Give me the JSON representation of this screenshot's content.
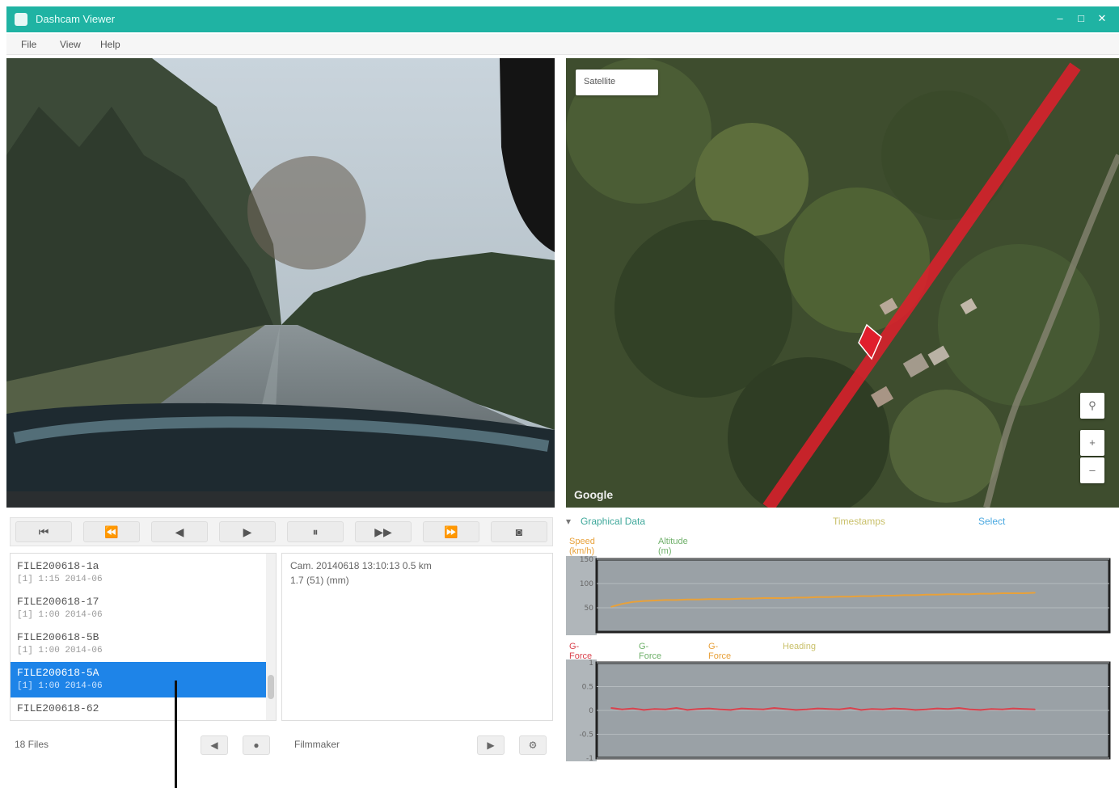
{
  "window": {
    "title": "Dashcam Viewer",
    "controls": [
      "–",
      "□",
      "✕"
    ]
  },
  "menu": [
    "File",
    "View",
    "Help"
  ],
  "map": {
    "type_selector": "Satellite",
    "zoom_in": "+",
    "zoom_out": "–",
    "pegman_icon": "person-icon",
    "logo": "Google"
  },
  "playback": {
    "buttons": [
      "skip-back-icon",
      "rewind-icon",
      "step-back-icon",
      "play-icon",
      "pause-icon",
      "step-forward-icon",
      "fast-forward-icon",
      "camera-icon"
    ]
  },
  "file_list": {
    "items": [
      {
        "name": "FILE200618-1a",
        "sub": "[1] 1:15 2014-06"
      },
      {
        "name": "FILE200618-17",
        "sub": "[1] 1:00 2014-06"
      },
      {
        "name": "FILE200618-5B",
        "sub": "[1] 1:00 2014-06"
      },
      {
        "name": "FILE200618-5A",
        "sub": "[1] 1:00 2014-06",
        "selected": true
      },
      {
        "name": "FILE200618-62",
        "sub": ""
      }
    ],
    "selected_index": 3
  },
  "info_panel": {
    "line1": "Cam. 20140618 13:10:13 0.5 km",
    "line2": "1.7 (51) (mm)"
  },
  "bottom_bar": {
    "count": "18 Files",
    "button1": "◀",
    "button2": "●",
    "label": "Filmmaker",
    "button3": "▶",
    "button4": "⚙"
  },
  "chart_panel": {
    "header": "Graphical Data",
    "export_label": "Timestamps",
    "settings_label": "Select",
    "legend_top": [
      "Speed (km/h)",
      "Altitude (m)"
    ],
    "legend_bottom": [
      "G-Force X",
      "G-Force Y",
      "G-Force Z",
      "Heading"
    ]
  },
  "chart_data": [
    {
      "type": "line",
      "name": "Speed / Altitude",
      "title": "",
      "ylim": [
        0,
        150
      ],
      "yticks": [
        50,
        100,
        150
      ],
      "series": [
        {
          "name": "Speed (km/h)",
          "color": "#e8a13a",
          "values": [
            52,
            58,
            62,
            64,
            65,
            66,
            66,
            67,
            67,
            68,
            68,
            68,
            69,
            69,
            70,
            70,
            70,
            71,
            71,
            72,
            72,
            73,
            73,
            74,
            74,
            75,
            75,
            76,
            76,
            77,
            77,
            78,
            78,
            78,
            79,
            79,
            80,
            80,
            80,
            81
          ]
        }
      ]
    },
    {
      "type": "line",
      "name": "G-Force",
      "title": "",
      "ylim": [
        -1,
        1
      ],
      "yticks": [
        -1,
        -0.5,
        0,
        0.5,
        1
      ],
      "series": [
        {
          "name": "G-Force X",
          "color": "#d9424d",
          "values": [
            0.05,
            0.02,
            0.04,
            0.01,
            0.03,
            0.02,
            0.05,
            0.01,
            0.03,
            0.04,
            0.02,
            0.01,
            0.04,
            0.03,
            0.02,
            0.05,
            0.03,
            0.01,
            0.02,
            0.04,
            0.03,
            0.02,
            0.05,
            0.01,
            0.03,
            0.02,
            0.04,
            0.03,
            0.01,
            0.02,
            0.04,
            0.03,
            0.05,
            0.02,
            0.01,
            0.03,
            0.02,
            0.04,
            0.03,
            0.02
          ]
        }
      ]
    }
  ],
  "colors": {
    "titlebar": "#1fb3a3",
    "selection": "#1e84e8",
    "route": "#e01e2c"
  }
}
